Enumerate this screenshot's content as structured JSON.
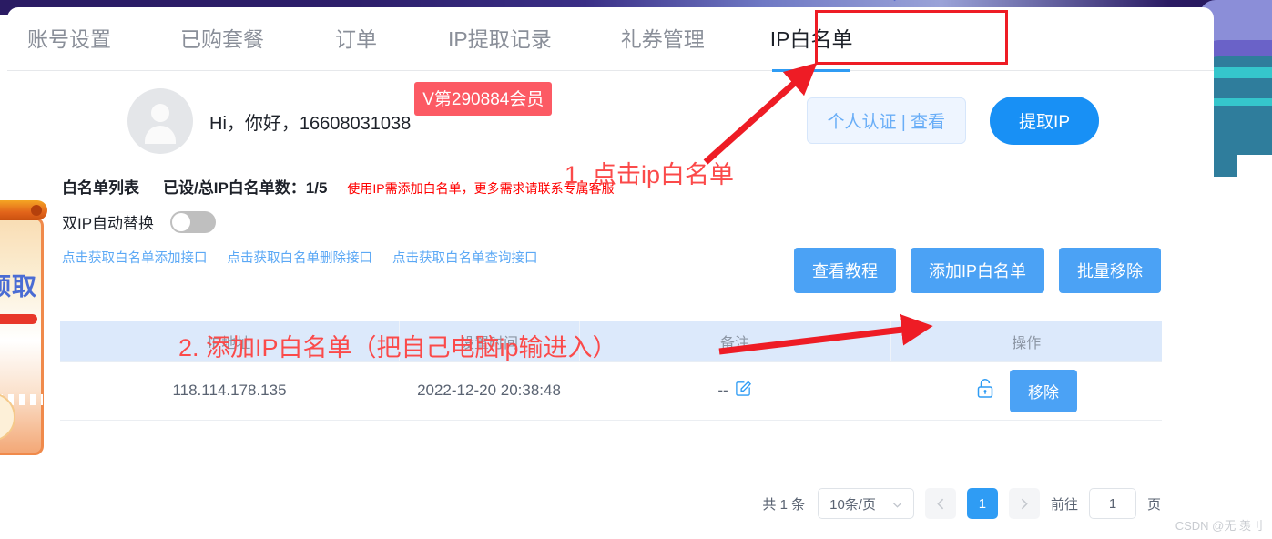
{
  "tabs": [
    {
      "label": "账号设置",
      "active": false
    },
    {
      "label": "已购套餐",
      "active": false
    },
    {
      "label": "订单",
      "active": false
    },
    {
      "label": "IP提取记录",
      "active": false
    },
    {
      "label": "礼券管理",
      "active": false
    },
    {
      "label": "IP白名单",
      "active": true
    }
  ],
  "user": {
    "greeting": "Hi，你好，16608031038",
    "vip_badge": "V第290884会员",
    "verify_button": "个人认证 | 查看",
    "extract_button": "提取IP",
    "avatar_icon": "user-avatar-icon"
  },
  "whitelist": {
    "title": "白名单列表",
    "count_label": "已设/总IP白名单数：1/5",
    "hint": "使用IP需添加白名单，更多需求请联系专属客服",
    "toggle_label": "双IP自动替换",
    "toggle_state": "off",
    "links": [
      "点击获取白名单添加接口",
      "点击获取白名单删除接口",
      "点击获取白名单查询接口"
    ],
    "buttons": [
      "查看教程",
      "添加IP白名单",
      "批量移除"
    ]
  },
  "table": {
    "columns": [
      "IP地址",
      "设置时间",
      "备注",
      "操作"
    ],
    "rows": [
      {
        "ip": "118.114.178.135",
        "time": "2022-12-20 20:38:48",
        "note": "--",
        "note_icon": "edit-pencil-icon",
        "lock_icon": "unlock-icon",
        "remove_button": "移除"
      }
    ]
  },
  "pagination": {
    "total_label": "共 1 条",
    "page_size": "10条/页",
    "prev_icon": "chevron-left-icon",
    "next_icon": "chevron-right-icon",
    "current_page": "1",
    "jump_prefix": "前往",
    "jump_value": "1",
    "jump_suffix": "页"
  },
  "promo": {
    "text": "领取"
  },
  "annotations": {
    "step1": "1. 点击ip白名单",
    "step2": "2. 添加IP白名单（把自己电脑ip输进入）",
    "box_color": "#ee1c25",
    "arrow_color": "#ee1c25",
    "text_color": "#fb4a4a"
  },
  "watermark": "CSDN @无 羡刂"
}
